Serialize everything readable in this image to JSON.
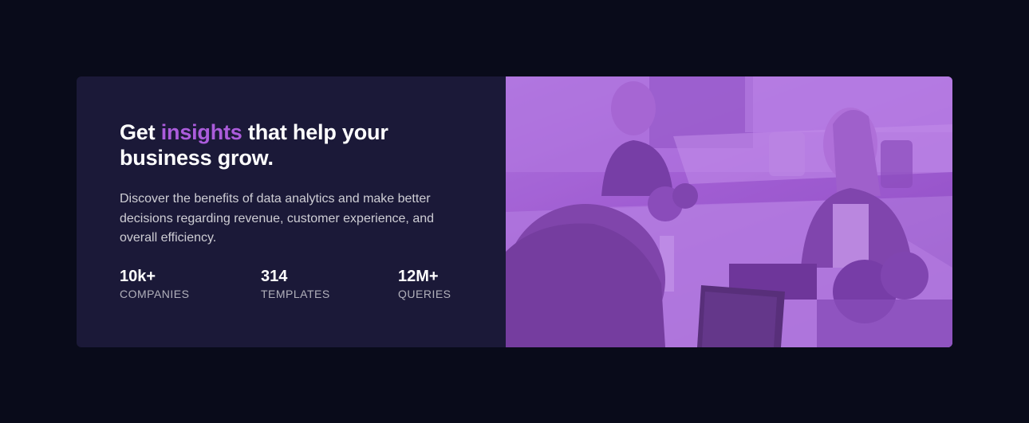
{
  "headline": {
    "before": "Get ",
    "accent": "insights",
    "after": " that help your business grow."
  },
  "description": "Discover the benefits of data analytics and make better decisions regarding revenue, customer experience, and overall efficiency.",
  "stats": [
    {
      "value": "10k+",
      "label": "Companies"
    },
    {
      "value": "314",
      "label": "Templates"
    },
    {
      "value": "12M+",
      "label": "Queries"
    }
  ],
  "colors": {
    "page_background": "#090b1a",
    "card_background": "#1b1938",
    "accent": "#ab5cdb",
    "image_overlay": "#aa5cdb"
  },
  "image": {
    "subject": "people working with laptops at an office table",
    "tint": "purple"
  }
}
